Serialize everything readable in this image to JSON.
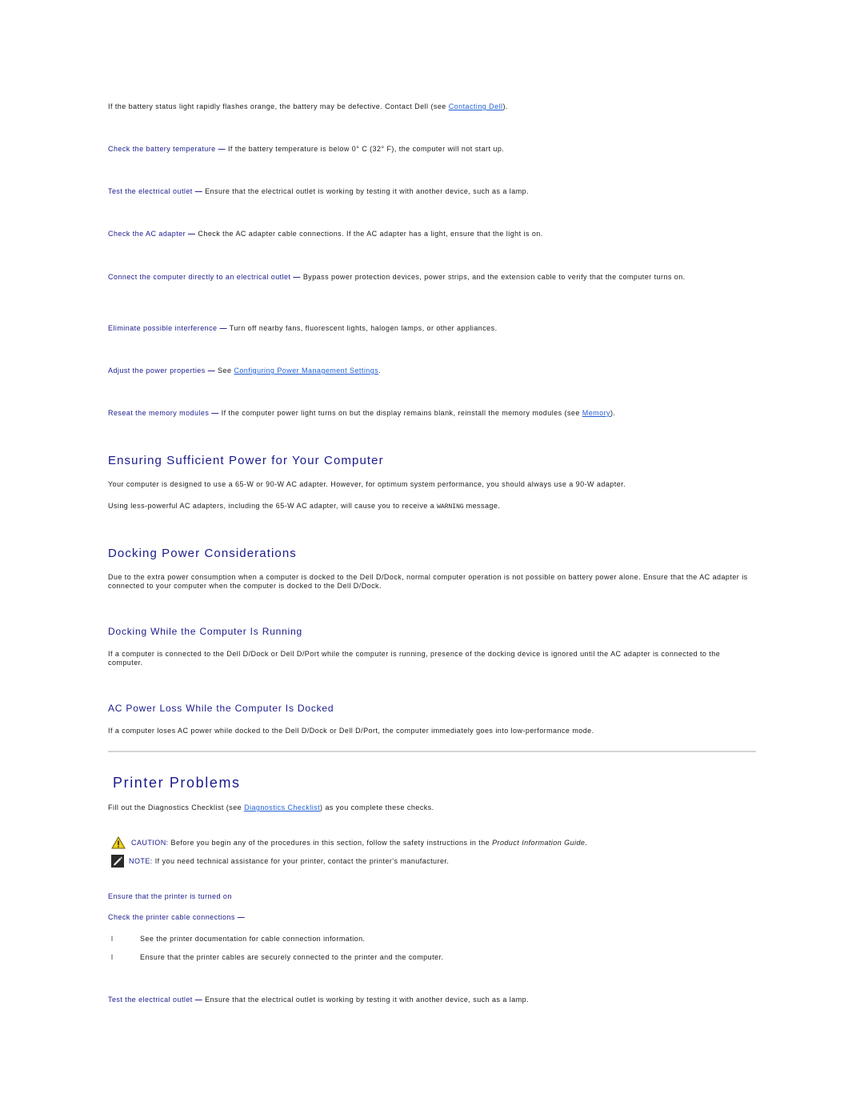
{
  "power_tips": {
    "battery_flash": {
      "text": "If the battery status light rapidly flashes orange, the battery may be defective. Contact Dell (see ",
      "link": "Contacting Dell",
      "after": ")."
    },
    "items": [
      {
        "term": "Check the battery temperature",
        "text": "If the battery temperature is below 0° C (32° F), the computer will not start up."
      },
      {
        "term": "Test the electrical outlet",
        "text": "Ensure that the electrical outlet is working by testing it with another device, such as a lamp."
      },
      {
        "term": "Check the AC adapter",
        "text": "Check the AC adapter cable connections. If the AC adapter has a light, ensure that the light is on."
      },
      {
        "term": "Connect the computer directly to an electrical outlet",
        "text": "Bypass power protection devices, power strips, and the extension cable to verify that the computer turns on."
      },
      {
        "term": "Eliminate possible interference",
        "text": "Turn off nearby fans, fluorescent lights, halogen lamps, or other appliances."
      }
    ],
    "adjust": {
      "term": "Adjust the power properties",
      "before": "See ",
      "link": "Configuring Power Management Settings",
      "after": "."
    },
    "reseat": {
      "term": "Reseat the memory modules",
      "before": "If the computer power light turns on but the display remains blank, reinstall the memory modules (see ",
      "link": "Memory",
      "after": ")."
    },
    "dash": "—"
  },
  "sufficient_power": {
    "heading": "Ensuring Sufficient Power for Your Computer",
    "para1": "Your computer is designed to use a 65-W or 90-W AC adapter. However, for optimum system performance, you should always use a 90-W adapter.",
    "para2_before": "Using less-powerful AC adapters, including the 65-W AC adapter, will cause you to receive a ",
    "para2_code": "WARNING",
    "para2_after": " message."
  },
  "docking": {
    "heading": "Docking Power Considerations",
    "para": "Due to the extra power consumption when a computer is docked to the Dell D/Dock, normal computer operation is not possible on battery power alone. Ensure that the AC adapter is connected to your computer when the computer is docked to the Dell D/Dock.",
    "running_heading": "Docking While the Computer Is Running",
    "running_para": "If a computer is connected to the Dell D/Dock or Dell D/Port while the computer is running, presence of the docking device is ignored until the AC adapter is connected to the computer.",
    "loss_heading": "AC Power Loss While the Computer Is Docked",
    "loss_para": "If a computer loses AC power while docked to the Dell D/Dock or Dell D/Port, the computer immediately goes into low-performance mode."
  },
  "printer": {
    "heading": "Printer Problems",
    "intro_before": "Fill out the Diagnostics Checklist (see ",
    "intro_link": "Diagnostics Checklist",
    "intro_after": ") as you complete these checks.",
    "caution_label": "CAUTION:",
    "caution_before": " Before you begin any of the procedures in this section, follow the safety instructions in the ",
    "caution_italic": "Product Information Guide",
    "caution_after": ".",
    "note_label": "NOTE:",
    "note_text": " If you need technical assistance for your printer, contact the printer's manufacturer.",
    "turned_on": "Ensure that the printer is turned on",
    "cable_term": "Check the printer cable connections",
    "bullet_glyph": "l",
    "bullets": [
      "See the printer documentation for cable connection information.",
      "Ensure that the printer cables are securely connected to the printer and the computer."
    ],
    "outlet_term": "Test the electrical outlet",
    "outlet_text": "Ensure that the electrical outlet is working by testing it with another device, such as a lamp."
  },
  "colors": {
    "heading": "#1a1a8c",
    "link": "#1f5fd6",
    "body_text": "#1a1a1a",
    "divider": "#d4d4d4",
    "caution_icon": "#f2d21a"
  }
}
